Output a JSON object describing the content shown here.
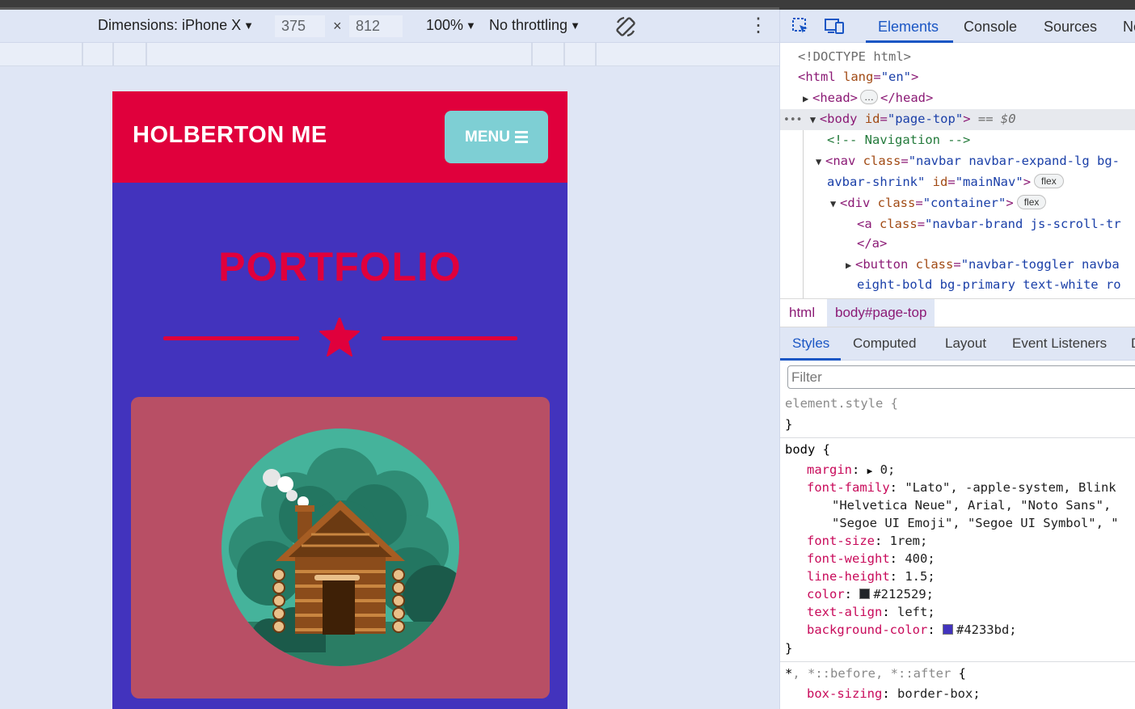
{
  "device_toolbar": {
    "dimensions_label": "Dimensions: iPhone X",
    "width_value": "375",
    "times": "×",
    "height_value": "812",
    "zoom": "100%",
    "throttling": "No throttling",
    "rotate_icon": "rotate-icon",
    "more_icon": "kebab-icon"
  },
  "page": {
    "brand": "HOLBERTON ME",
    "menu_label": "MENU",
    "section_title": "PORTFOLIO",
    "colors": {
      "nav_bg": "#e0003c",
      "page_bg": "#4233bd",
      "menu_bg": "#7ecfd4",
      "card_bg": "#b84f65"
    }
  },
  "devtools": {
    "tabs": [
      "Elements",
      "Console",
      "Sources",
      "Ne"
    ],
    "active_tab": "Elements",
    "dom": {
      "doctype": "<!DOCTYPE html>",
      "html_open": "<html",
      "html_lang_attr": "lang",
      "html_lang_val": "\"en\"",
      "head_open": "<head>",
      "head_close": "</head>",
      "ellipsis": "…",
      "body_open": "<body",
      "body_id_attr": "id",
      "body_id_val": "\"page-top\"",
      "body_marker": "== $0",
      "comment": "<!-- Navigation -->",
      "nav_open": "<nav",
      "nav_class_attr": "class",
      "nav_class_val": "\"navbar navbar-expand-lg bg-",
      "nav_cont": "avbar-shrink\"",
      "nav_id_attr": "id",
      "nav_id_val": "\"mainNav\"",
      "div_open": "<div",
      "div_class_attr": "class",
      "div_class_val": "\"container\"",
      "a_open": "<a",
      "a_class_attr": "class",
      "a_class_val": "\"navbar-brand js-scroll-tr",
      "a_close": "</a>",
      "button_open": "<button",
      "button_class_attr": "class",
      "button_class_val": "\"navbar-toggler navba",
      "button_cont": "eight-bold bg-primary text-white ro",
      "flex_badge": "flex"
    },
    "breadcrumbs": [
      "html",
      "body#page-top"
    ],
    "styles_tabs": [
      "Styles",
      "Computed",
      "Layout",
      "Event Listeners",
      "D"
    ],
    "filter_placeholder": "Filter",
    "element_style": "element.style {",
    "close_brace": "}",
    "body_selector": "body {",
    "body_rules": [
      {
        "prop": "margin",
        "value": "0;"
      },
      {
        "prop": "font-family",
        "value": "\"Lato\", -apple-system, Blink"
      },
      {
        "prop": "",
        "value": "\"Helvetica Neue\", Arial, \"Noto Sans\","
      },
      {
        "prop": "",
        "value": "\"Segoe UI Emoji\", \"Segoe UI Symbol\", \""
      },
      {
        "prop": "font-size",
        "value": "1rem;"
      },
      {
        "prop": "font-weight",
        "value": "400;"
      },
      {
        "prop": "line-height",
        "value": "1.5;"
      },
      {
        "prop": "color",
        "value": "#212529;"
      },
      {
        "prop": "text-align",
        "value": "left;"
      },
      {
        "prop": "background-color",
        "value": "#4233bd;"
      }
    ],
    "swatch_colors": {
      "color": "#212529",
      "background": "#4233bd"
    },
    "universal_selector_a": "*",
    "universal_selector_b": ", *::before, *::after",
    "universal_brace": " {",
    "box_sizing": {
      "prop": "box-sizing",
      "value": "border-box;"
    }
  }
}
